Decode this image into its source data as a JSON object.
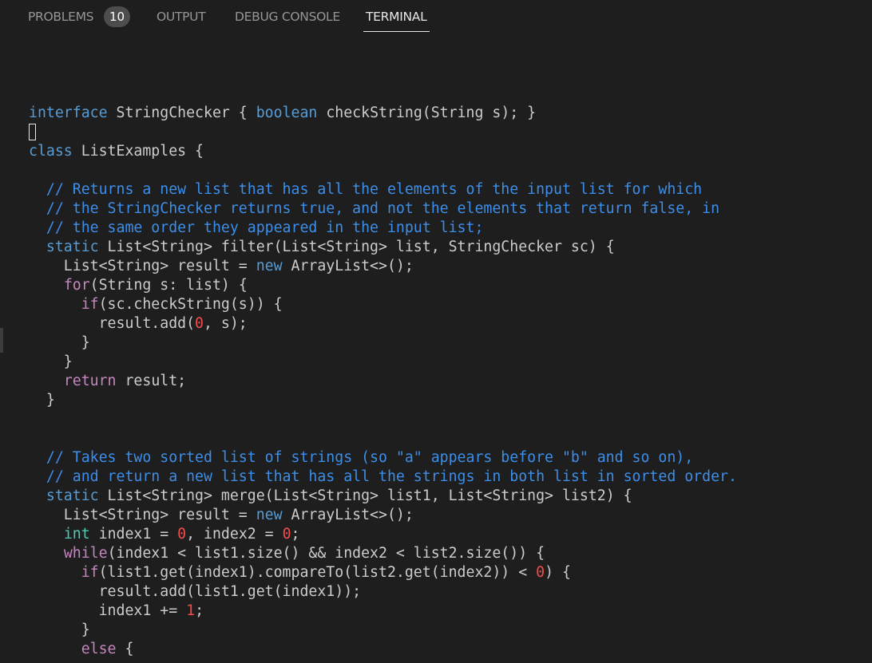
{
  "panel": {
    "tabs": {
      "problems": "PROBLEMS",
      "problems_count": "10",
      "output": "OUTPUT",
      "debug_console": "DEBUG CONSOLE",
      "terminal": "TERMINAL"
    },
    "active_tab": "TERMINAL"
  },
  "terminal": {
    "lines": [
      [
        {
          "t": "interface",
          "c": "kw"
        },
        {
          "t": " StringChecker { "
        },
        {
          "t": "boolean",
          "c": "kw"
        },
        {
          "t": " checkString(String s); }"
        }
      ],
      [
        {
          "t": ""
        }
      ],
      [
        {
          "t": "class",
          "c": "kw"
        },
        {
          "t": " ListExamples {"
        }
      ],
      [
        {
          "t": ""
        }
      ],
      [
        {
          "t": "  // Returns a new list that has all the elements of the input list for which",
          "c": "cm"
        }
      ],
      [
        {
          "t": "  // the StringChecker returns true, and not the elements that return false, in",
          "c": "cm"
        }
      ],
      [
        {
          "t": "  // the same order they appeared in the input list;",
          "c": "cm"
        }
      ],
      [
        {
          "t": "  "
        },
        {
          "t": "static",
          "c": "kw"
        },
        {
          "t": " List<String> filter(List<String> list, StringChecker sc) {"
        }
      ],
      [
        {
          "t": "    List<String> result = "
        },
        {
          "t": "new",
          "c": "kw"
        },
        {
          "t": " ArrayList<>();"
        }
      ],
      [
        {
          "t": "    "
        },
        {
          "t": "for",
          "c": "ctl"
        },
        {
          "t": "(String s: list) {"
        }
      ],
      [
        {
          "t": "      "
        },
        {
          "t": "if",
          "c": "ctl"
        },
        {
          "t": "(sc.checkString(s)) {"
        }
      ],
      [
        {
          "t": "        result.add("
        },
        {
          "t": "0",
          "c": "num"
        },
        {
          "t": ", s);"
        }
      ],
      [
        {
          "t": "      }"
        }
      ],
      [
        {
          "t": "    }"
        }
      ],
      [
        {
          "t": "    "
        },
        {
          "t": "return",
          "c": "ctl"
        },
        {
          "t": " result;"
        }
      ],
      [
        {
          "t": "  }"
        }
      ],
      [
        {
          "t": ""
        }
      ],
      [
        {
          "t": ""
        }
      ],
      [
        {
          "t": "  // Takes two sorted list of strings (so \"a\" appears before \"b\" and so on),",
          "c": "cm"
        }
      ],
      [
        {
          "t": "  // and return a new list that has all the strings in both list in sorted order.",
          "c": "cm"
        }
      ],
      [
        {
          "t": "  "
        },
        {
          "t": "static",
          "c": "kw"
        },
        {
          "t": " List<String> merge(List<String> list1, List<String> list2) {"
        }
      ],
      [
        {
          "t": "    List<String> result = "
        },
        {
          "t": "new",
          "c": "kw"
        },
        {
          "t": " ArrayList<>();"
        }
      ],
      [
        {
          "t": "    "
        },
        {
          "t": "int",
          "c": "ty"
        },
        {
          "t": " index1 = "
        },
        {
          "t": "0",
          "c": "num"
        },
        {
          "t": ", index2 = "
        },
        {
          "t": "0",
          "c": "num"
        },
        {
          "t": ";"
        }
      ],
      [
        {
          "t": "    "
        },
        {
          "t": "while",
          "c": "ctl"
        },
        {
          "t": "(index1 < list1.size() && index2 < list2.size()) {"
        }
      ],
      [
        {
          "t": "      "
        },
        {
          "t": "if",
          "c": "ctl"
        },
        {
          "t": "(list1.get(index1).compareTo(list2.get(index2)) < "
        },
        {
          "t": "0",
          "c": "num"
        },
        {
          "t": ") {"
        }
      ],
      [
        {
          "t": "        result.add(list1.get(index1));"
        }
      ],
      [
        {
          "t": "        index1 += "
        },
        {
          "t": "1",
          "c": "num"
        },
        {
          "t": ";"
        }
      ],
      [
        {
          "t": "      }"
        }
      ],
      [
        {
          "t": "      "
        },
        {
          "t": "else",
          "c": "ctl"
        },
        {
          "t": " {"
        }
      ]
    ]
  },
  "colors": {
    "background": "#1e1e1e",
    "text": "#cccccc",
    "keyword": "#569cd6",
    "control": "#c586c0",
    "comment": "#3b8eea",
    "number": "#f14c4c",
    "type": "#4ec9b0"
  }
}
